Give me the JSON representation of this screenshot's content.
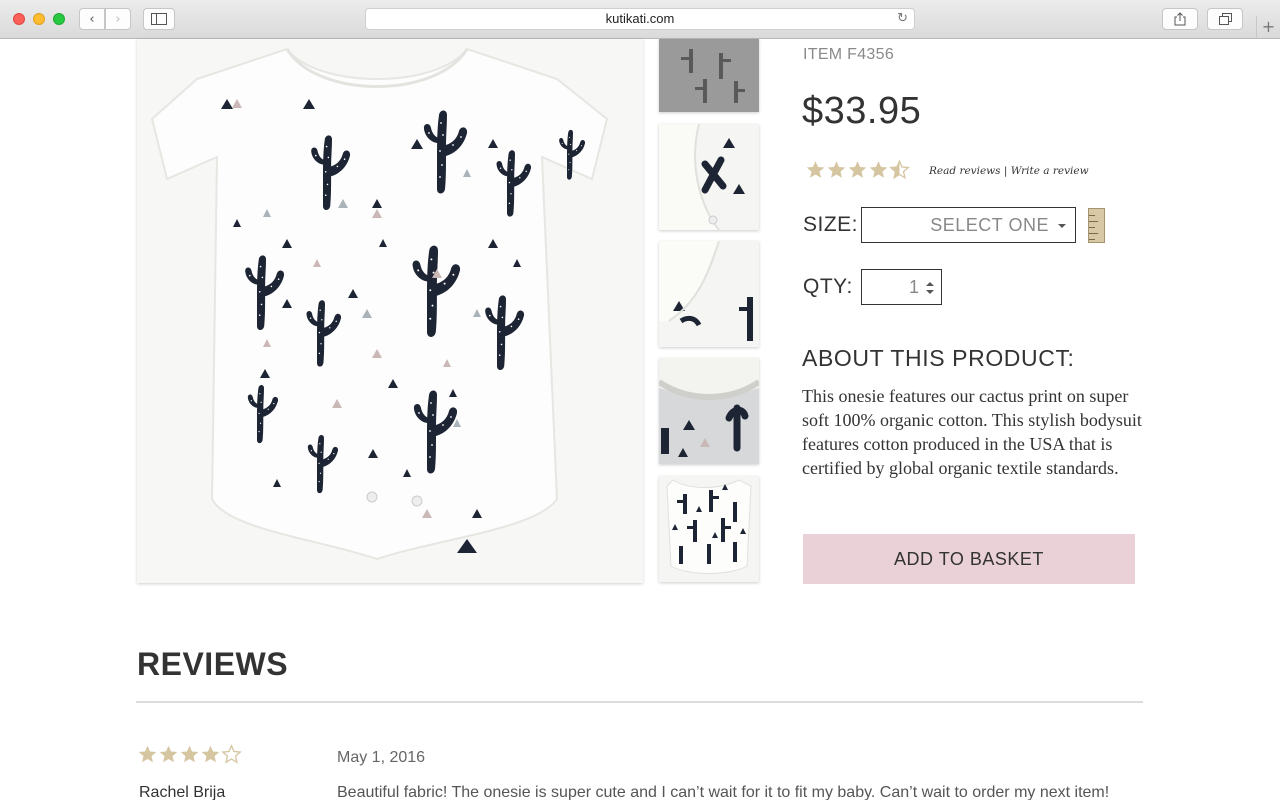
{
  "browser": {
    "url": "kutikati.com"
  },
  "product": {
    "item_number": "ITEM F4356",
    "price": "$33.95",
    "rating": 4.5,
    "review_links": {
      "read": "Read reviews",
      "separator": "|",
      "write": "Write a review"
    },
    "size": {
      "label": "SIZE:",
      "selected": "SELECT ONE"
    },
    "qty": {
      "label": "QTY:",
      "value": "1"
    },
    "about": {
      "title": "ABOUT THIS PRODUCT:",
      "text": "This onesie features our cactus print on super soft 100% organic cotton. This stylish bodysuit features cotton produced in the USA that is certified by global organic textile standards."
    },
    "add_to_basket": "ADD TO BASKET"
  },
  "reviews": {
    "heading": "REVIEWS",
    "items": [
      {
        "rating": 4,
        "date": "May 1, 2016",
        "author": "Rachel Brija",
        "text": "Beautiful fabric! The onesie is super cute and I can’t wait for it to fit my baby. Can’t wait to order my next item!"
      }
    ]
  },
  "colors": {
    "star": "#d5c5a1",
    "basket_button": "#ead0d7",
    "print": "#1d2433"
  }
}
